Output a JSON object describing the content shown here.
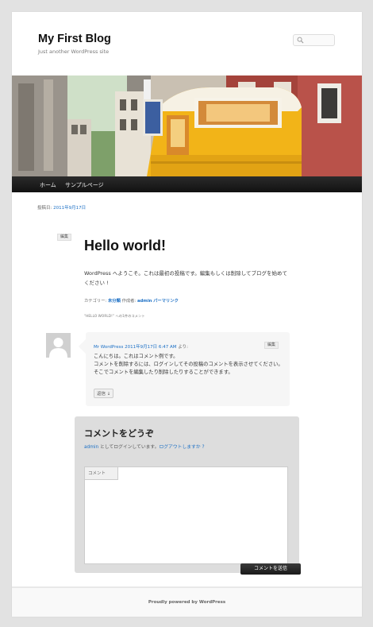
{
  "site": {
    "title": "My First Blog",
    "description": "Just another WordPress site",
    "search_placeholder": ""
  },
  "nav": {
    "items": [
      {
        "label": "ホーム"
      },
      {
        "label": "サンプルページ"
      }
    ]
  },
  "post": {
    "posted_label": "投稿日:",
    "date": "2011年9月17日",
    "edit_label": "編集",
    "title": "Hello world!",
    "body": "WordPress へようこそ。これは最初の投稿です。編集もしくは削除してブログを始めてください !",
    "meta": {
      "category_label": "カテゴリー:",
      "category": "未分類",
      "author_label": "作成者:",
      "author": "admin",
      "permalink": "パーマリンク"
    },
    "responses_title": "“HELLO WORLD!” への1件のコメント"
  },
  "comment": {
    "author": "Mr WordPress",
    "date": "2011年9月17日 6:47 AM",
    "says": "より:",
    "edit_label": "編集",
    "lines": [
      "こんにちは。これはコメント例です。",
      "コメントを削除するには、ログインしてその投稿のコメントを表示させてください。",
      "そこでコメントを編集したり削除したりすることができます。"
    ],
    "reply_label": "返信 ↓"
  },
  "respond": {
    "title": "コメントをどうぞ",
    "logged_user": "admin",
    "logged_text": " としてログインしています。",
    "logout": "ログアウトしますか ?",
    "textarea_label": "コメント",
    "submit_label": "コメントを送信"
  },
  "footer": {
    "text": "Proudly powered by WordPress"
  },
  "colors": {
    "link": "#1b6fc5",
    "page_bg": "#e2e2e2",
    "tram_yellow": "#f2b418"
  }
}
